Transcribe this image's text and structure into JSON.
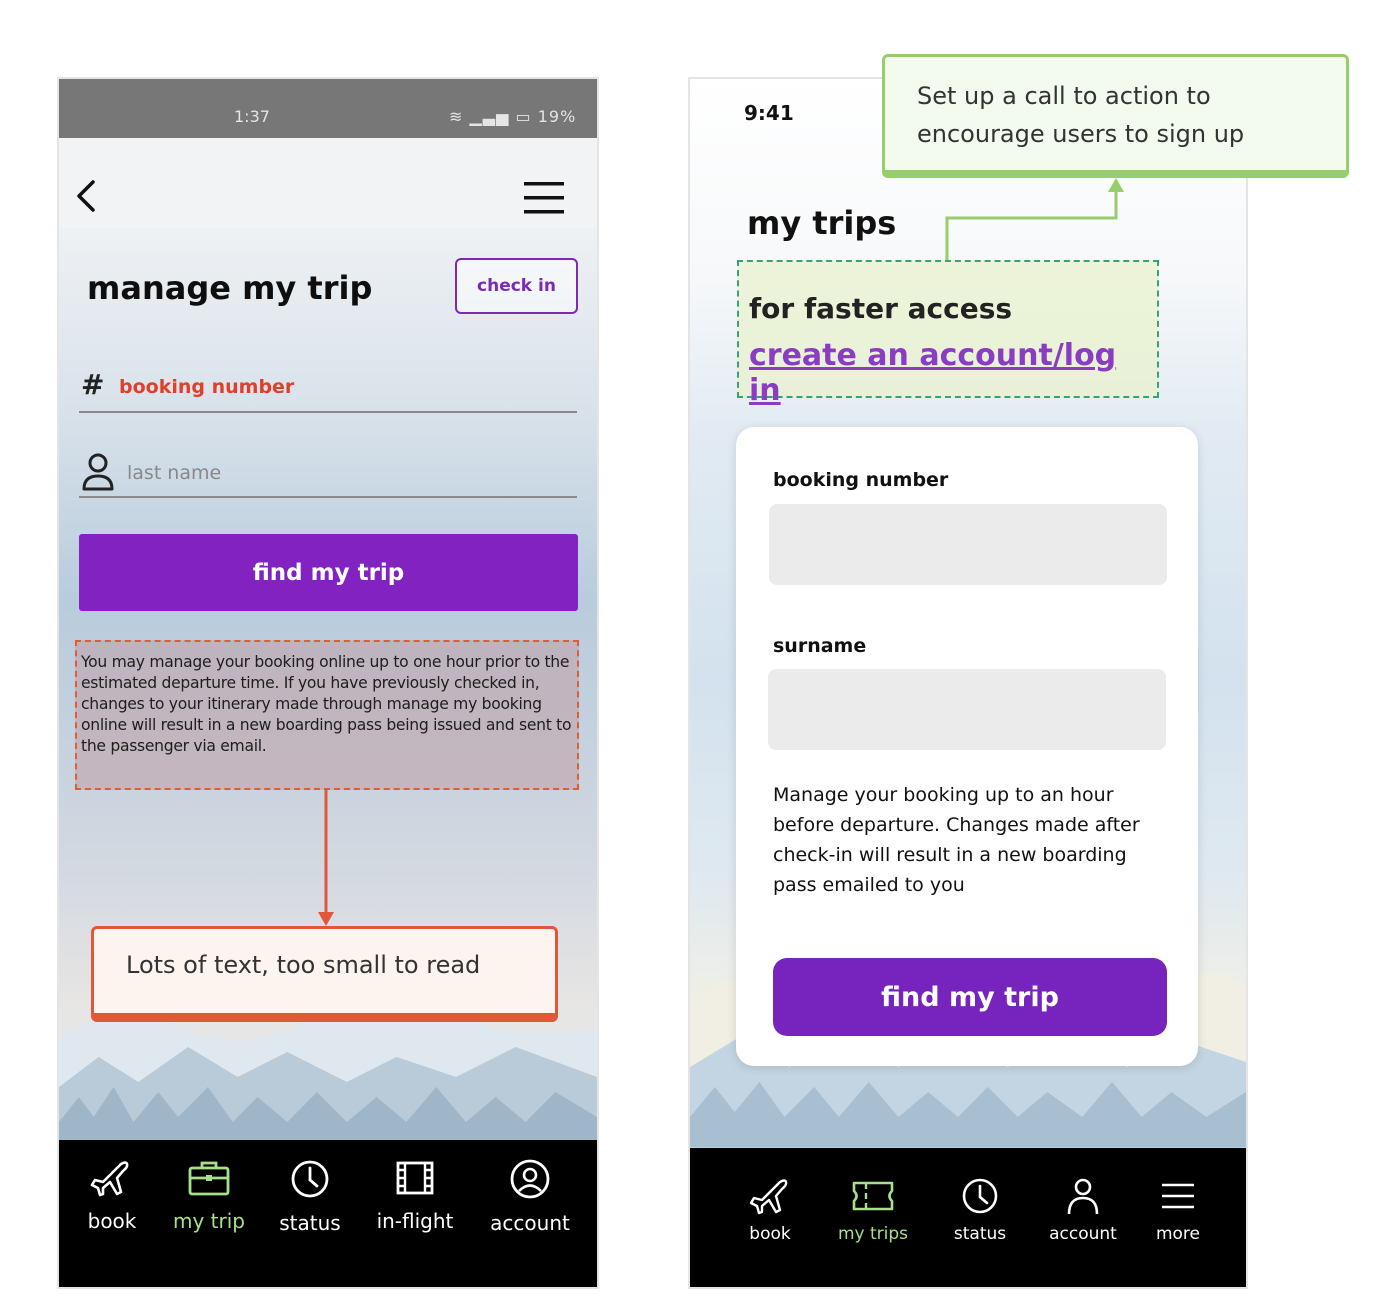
{
  "left_screen": {
    "status_bar": {
      "time": "1:37",
      "battery": "19%"
    },
    "title": "manage my trip",
    "check_in_label": "check in",
    "booking_placeholder": "booking number",
    "last_name_placeholder": "last name",
    "find_button": "find my trip",
    "info_text": "You may manage your booking online up to one hour prior to the estimated departure time. If you have previously checked in, changes to your itinerary made through manage my booking online will result in a new boarding pass being issued and sent to the passenger via email.",
    "nav": [
      {
        "label": "book",
        "icon": "plane-icon"
      },
      {
        "label": "my trip",
        "icon": "briefcase-icon",
        "active": true
      },
      {
        "label": "status",
        "icon": "clock-icon"
      },
      {
        "label": "in-flight",
        "icon": "film-icon"
      },
      {
        "label": "account",
        "icon": "user-circle-icon"
      }
    ],
    "annotation": "Lots of text, too small to read",
    "annotation_color": "#e2573a"
  },
  "right_screen": {
    "time": "9:41",
    "title": "my trips",
    "cta_text": "for faster access",
    "cta_link": "create an account/log in",
    "booking_label": "booking number",
    "surname_label": "surname",
    "help_text": "Manage your booking up to an hour before departure. Changes made after check-in will result in a new boarding pass emailed to you",
    "find_button": "find my trip",
    "nav": [
      {
        "label": "book",
        "icon": "plane-icon"
      },
      {
        "label": "my trips",
        "icon": "ticket-icon",
        "active": true
      },
      {
        "label": "status",
        "icon": "clock-icon"
      },
      {
        "label": "account",
        "icon": "user-icon"
      },
      {
        "label": "more",
        "icon": "menu-icon"
      }
    ],
    "annotation": "Set up a call to action to encourage users to sign up",
    "annotation_color": "#97cd6c"
  },
  "colors": {
    "primary_purple": "#8122c1",
    "active_nav": "#a7e08a",
    "error_red": "#e0402a"
  }
}
